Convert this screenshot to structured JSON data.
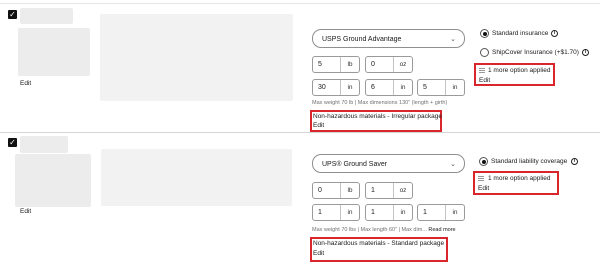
{
  "shipments": [
    {
      "edit_label": "Edit",
      "service": {
        "selected": "USPS Ground Advantage"
      },
      "weight": {
        "lb": {
          "value": "5",
          "unit": "lb"
        },
        "oz": {
          "value": "0",
          "unit": "oz"
        }
      },
      "dimensions": [
        {
          "value": "30",
          "unit": "in"
        },
        {
          "value": "6",
          "unit": "in"
        },
        {
          "value": "5",
          "unit": "in"
        }
      ],
      "limits_text": "Max weight 70 lb | Max dimensions 130\" (length + girth)",
      "read_more": "",
      "hazmat": {
        "text": "Non-hazardous materials - Irregular package",
        "edit": "Edit"
      },
      "insurance": [
        {
          "label": "Standard insurance",
          "selected": true
        },
        {
          "label": "ShipCover Insurance (+$1.70)",
          "selected": false
        }
      ],
      "options": {
        "text": "1 more option applied",
        "edit": "Edit"
      }
    },
    {
      "edit_label": "Edit",
      "service": {
        "selected": "UPS® Ground Saver"
      },
      "weight": {
        "lb": {
          "value": "0",
          "unit": "lb"
        },
        "oz": {
          "value": "1",
          "unit": "oz"
        }
      },
      "dimensions": [
        {
          "value": "1",
          "unit": "in"
        },
        {
          "value": "1",
          "unit": "in"
        },
        {
          "value": "1",
          "unit": "in"
        }
      ],
      "limits_text": "Max weight 70 lbs | Max length 60\" | Max dim...",
      "read_more": "Read more",
      "hazmat": {
        "text": "Non-hazardous materials - Standard package",
        "edit": "Edit"
      },
      "insurance": [
        {
          "label": "Standard liability coverage",
          "selected": true
        }
      ],
      "options": {
        "text": "1 more option applied",
        "edit": "Edit"
      }
    }
  ],
  "colors": {
    "highlight": "#d9262d",
    "text": "#191919",
    "muted": "#707070"
  },
  "icons": {
    "select_chevron": "chevron-down-icon",
    "info": "info-icon",
    "options": "options-list-icon",
    "check": "checkbox-checked-icon"
  }
}
